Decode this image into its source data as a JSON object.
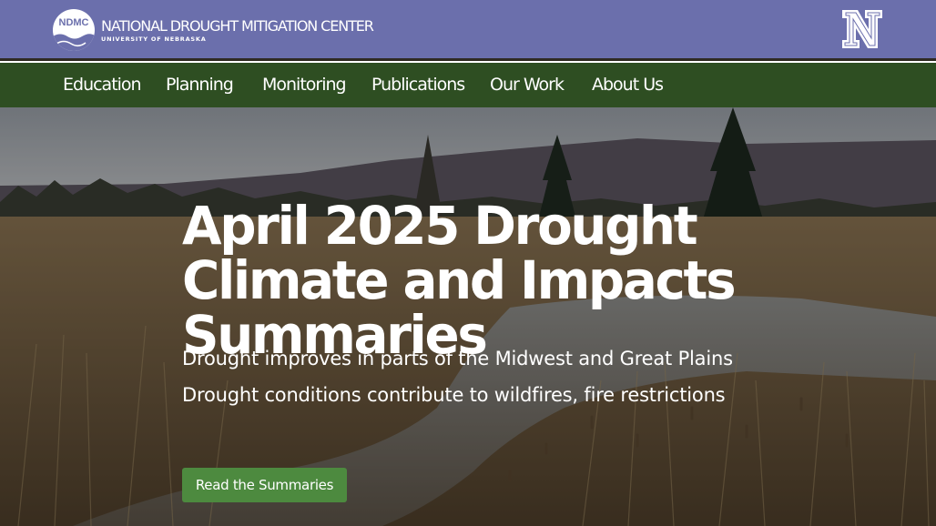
{
  "header": {
    "logo_abbr": "NDMC",
    "org_name": "NATIONAL DROUGHT MITIGATION CENTER",
    "org_sub": "UNIVERSITY OF NEBRASKA",
    "university_icon": "nebraska-n-logo"
  },
  "nav": {
    "items": [
      {
        "label": "Education"
      },
      {
        "label": "Planning"
      },
      {
        "label": "Monitoring"
      },
      {
        "label": "Publications"
      },
      {
        "label": "Our Work"
      },
      {
        "label": "About Us"
      }
    ]
  },
  "hero": {
    "title": "April 2025 Drought Climate and Impacts Summaries",
    "line1": "Drought improves in parts of the Midwest and Great Plains",
    "line2": "Drought conditions contribute to wildfires, fire restrictions",
    "button_label": "Read the Summaries"
  },
  "colors": {
    "topbar": "#6b6fac",
    "navbar": "#2e4e22",
    "button": "#4d8a3f",
    "text": "#ffffff"
  }
}
